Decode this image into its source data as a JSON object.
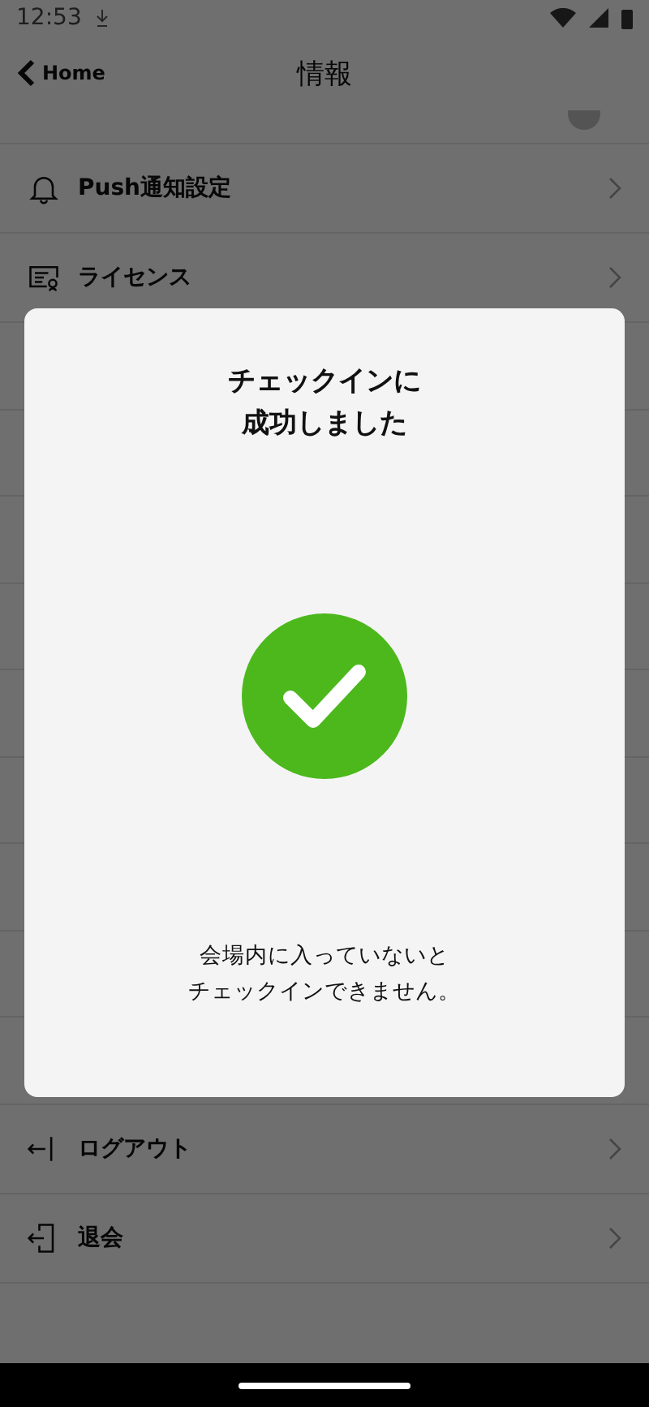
{
  "status_bar": {
    "time": "12:53"
  },
  "header": {
    "back": "Home",
    "title": "情報"
  },
  "menu_top": [
    {
      "label": "Push通知設定",
      "kind": "bell"
    },
    {
      "label": "ライセンス",
      "kind": "license"
    }
  ],
  "menu_bottom": [
    {
      "label": "ログアウト",
      "kind": "logout"
    },
    {
      "label": "退会",
      "kind": "withdraw"
    }
  ],
  "dialog": {
    "title_lines": [
      "チェックインに",
      "成功しました"
    ],
    "message_lines": [
      "会場内に入っていないと",
      "チェックインできません。"
    ]
  }
}
